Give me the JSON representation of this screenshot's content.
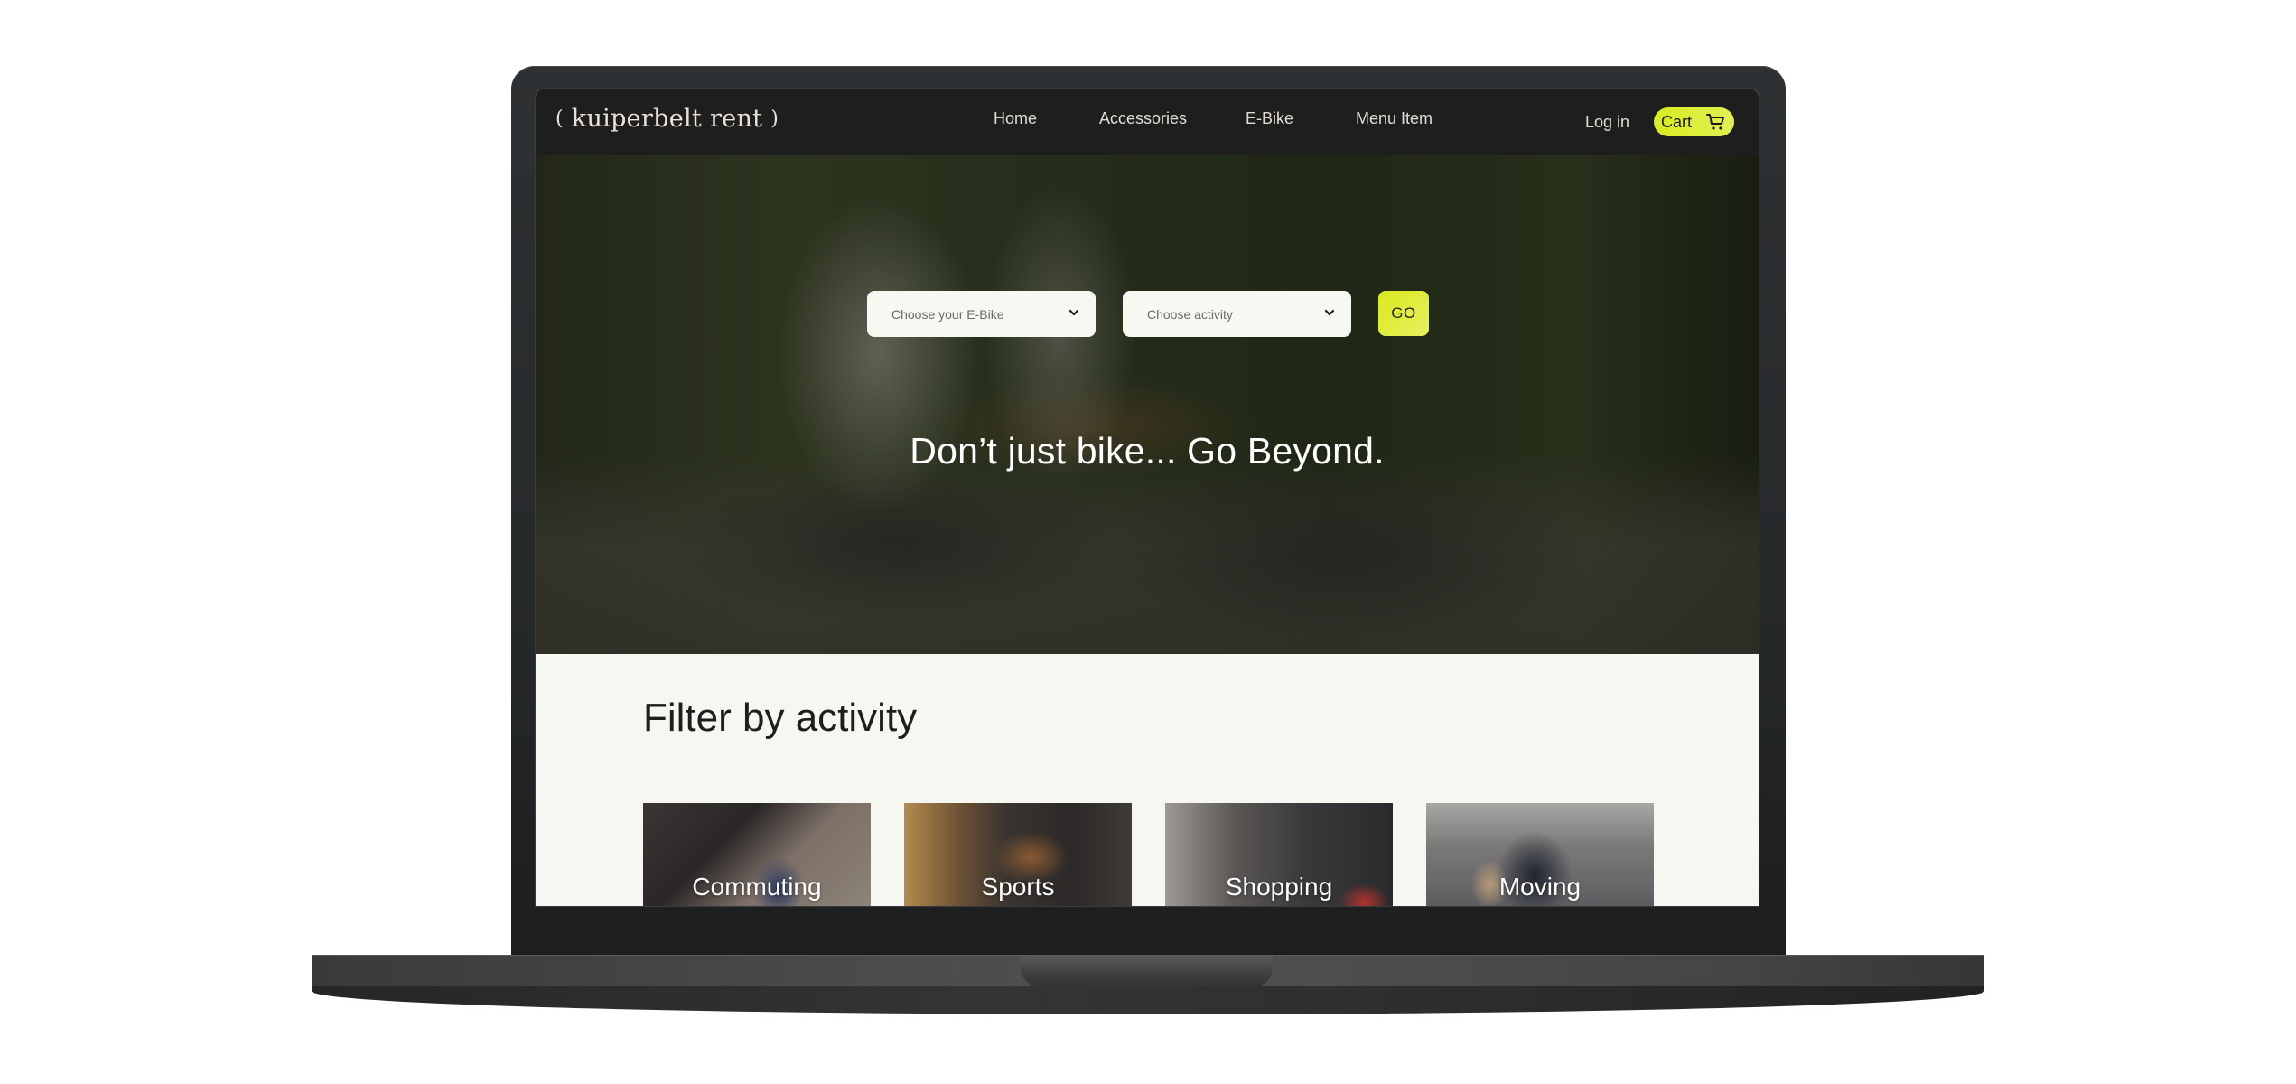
{
  "header": {
    "logo": {
      "open": "(",
      "text": "kuiperbelt rent",
      "close": ")"
    },
    "nav": [
      {
        "label": "Home"
      },
      {
        "label": "Accessories"
      },
      {
        "label": "E-Bike"
      },
      {
        "label": "Menu Item"
      }
    ],
    "login_label": "Log in",
    "cart_label": "Cart",
    "cart_icon": "shopping-cart-icon"
  },
  "hero": {
    "bike_select_placeholder": "Choose your E-Bike",
    "activity_select_placeholder": "Choose activity",
    "select_icon": "chevron-down-icon",
    "go_label": "GO",
    "headline": "Don’t just bike... Go Beyond."
  },
  "activities": {
    "title": "Filter by activity",
    "cards": [
      {
        "label": "Commuting"
      },
      {
        "label": "Sports"
      },
      {
        "label": "Shopping"
      },
      {
        "label": "Moving"
      }
    ]
  },
  "colors": {
    "accent": "#dcec2a",
    "header_bg": "#1e1e1e",
    "page_bg": "#f7f7f2",
    "select_bg": "#f8f8f3",
    "nav_text": "#e2ddd3"
  }
}
